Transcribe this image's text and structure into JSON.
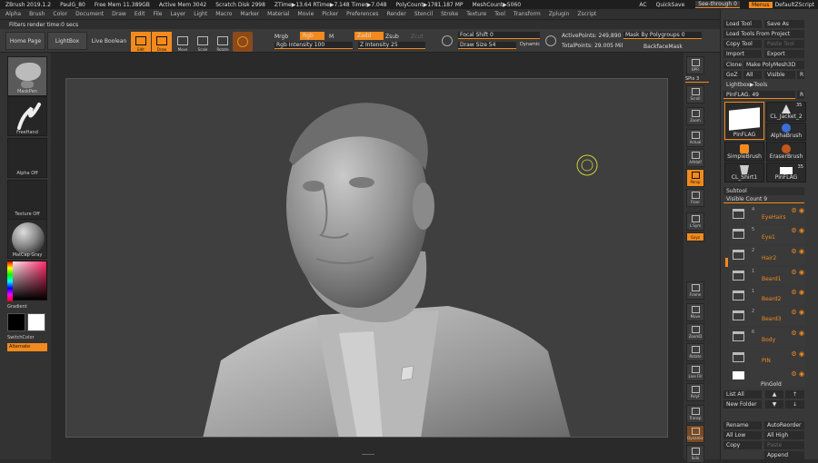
{
  "title": {
    "app": "ZBrush 2019.1.2",
    "doc": "PaulG_80",
    "free_mem": "Free Mem 11.389GB",
    "active_mem": "Active Mem 3042",
    "scratch": "Scratch Disk 2998",
    "ztime": "ZTime▶13.64 RTime▶7.148 Timer▶7.048",
    "polycount": "PolyCount▶1781.187 MP",
    "meshcount": "MeshCount▶5060",
    "ac": "AC",
    "quicksave": "QuickSave",
    "see_through": "See-through  0",
    "menus": "Menus",
    "zscript": "DefaultZScript"
  },
  "menu": [
    "Alpha",
    "Brush",
    "Color",
    "Document",
    "Draw",
    "Edit",
    "File",
    "Layer",
    "Light",
    "Macro",
    "Marker",
    "Material",
    "Movie",
    "Picker",
    "Preferences",
    "Render",
    "Stencil",
    "Stroke",
    "Texture",
    "Tool",
    "Transform",
    "Zplugin",
    "Zscript"
  ],
  "status": "Filters render time:0 secs",
  "toolbar": {
    "home": "Home Page",
    "lightbox": "LightBox",
    "live_boolean": "Live Boolean",
    "edit": "Edit",
    "draw": "Draw",
    "move": "Move",
    "scale": "Scale",
    "rotate": "Rotate",
    "mrgb": "Mrgb",
    "rgb": "Rgb",
    "m": "M",
    "rgb_intensity": "Rgb Intensity 100",
    "zadd": "Zadd",
    "zsub": "Zsub",
    "zcut": "Zcut",
    "z_intensity": "Z Intensity 25",
    "focal": "Focal Shift 0",
    "draw_size": "Draw Size 54",
    "dynamic": "Dynamic",
    "active_points": "ActivePoints: 249,890",
    "total_points": "TotalPoints: 29.005 Mil",
    "mask_by_poly": "Mask By Polygroups 0",
    "backface": "BackfaceMask"
  },
  "left": {
    "brush": "MaskPen",
    "stroke": "FreeHand",
    "alpha": "Alpha Off",
    "texture": "Texture Off",
    "material": "MatCap Gray",
    "gradient": "Gradient",
    "switch": "SwitchColor",
    "alternate": "Alternate"
  },
  "right_shelf": [
    "BPR",
    "SPix 3",
    "Scroll",
    "Zoom",
    "Actual",
    "AAHalf",
    "Persp",
    "Floor",
    "L.Sym",
    "Gxyz",
    "Frame",
    "Move",
    "ZoomD",
    "Rotate",
    "Line Fill",
    "PolyF",
    "Transp",
    "Dynamic",
    "Solo"
  ],
  "tool": {
    "load": "Load Tool",
    "save_as": "Save As",
    "load_project": "Load Tools From Project",
    "copy": "Copy Tool",
    "paste": "Paste Tool",
    "import": "Import",
    "export": "Export",
    "clone": "Clone",
    "make_poly": "Make PolyMesh3D",
    "goz": "GoZ",
    "all": "All",
    "visible": "Visible",
    "r": "R",
    "lightbox_tools": "Lightbox▶Tools",
    "pinflag": "PinFLAG. 49",
    "thumbs": [
      {
        "name": "PinFLAG",
        "count": ""
      },
      {
        "name": "CL_Jacket_2",
        "count": ""
      },
      {
        "name": "",
        "count": ""
      },
      {
        "name": "AlphaBrush",
        "count": ""
      },
      {
        "name": "SimpleBrush",
        "count": ""
      },
      {
        "name": "EraserBrush",
        "count": ""
      },
      {
        "name": "CL_Shirt1",
        "count": ""
      },
      {
        "name": "PinFLAG",
        "count": "35"
      }
    ],
    "thumb_count": "35"
  },
  "subtool": {
    "header": "Subtool",
    "visible_count": "Visible Count 9",
    "items": [
      {
        "num": "4",
        "name": "EyeHairs"
      },
      {
        "num": "5",
        "name": "Eye1"
      },
      {
        "num": "2",
        "name": "Hair2"
      },
      {
        "num": "1",
        "name": "Beard1"
      },
      {
        "num": "1",
        "name": "Beard2"
      },
      {
        "num": "2",
        "name": "Beard3"
      },
      {
        "num": "6",
        "name": "Body"
      },
      {
        "num": "",
        "name": "PIN"
      },
      {
        "num": "",
        "name": "PinGold"
      }
    ],
    "list_all": "List All",
    "new_folder": "New Folder",
    "rename": "Rename",
    "auto_reorder": "AutoReorder",
    "all_low": "All Low",
    "all_high": "All High",
    "copy": "Copy",
    "paste": "Paste",
    "append": "Append"
  },
  "colors": {
    "accent": "#f28a1d",
    "panel": "#383838",
    "canvas": "#3f3f3f"
  }
}
